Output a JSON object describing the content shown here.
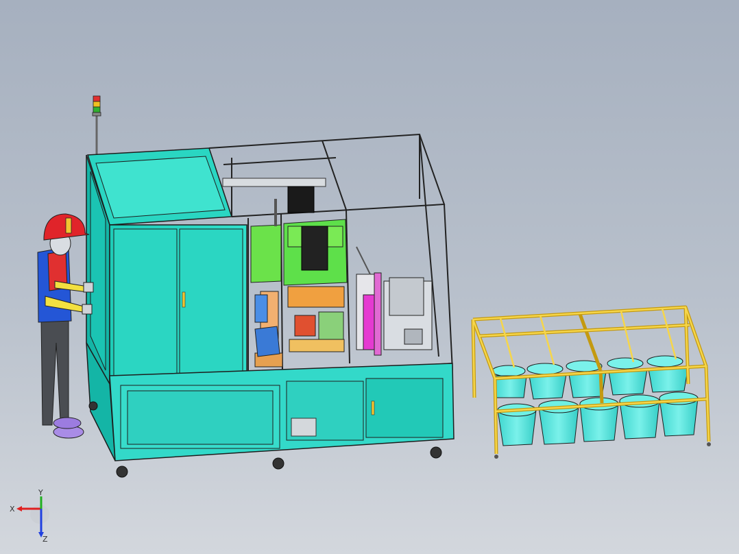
{
  "window": {
    "title": ""
  },
  "viewport": {
    "background_top": "#a6b0bf",
    "background_bottom": "#d3d7dd"
  },
  "model": {
    "frame_color": "#2b2b2b",
    "panel_color": "#22d3c0",
    "panel_light": "#6ff0e4",
    "rack_color": "#f2c531",
    "bucket_color": "#5ce8e0",
    "green_color": "#5ee04a",
    "magenta_color": "#e53ad1"
  },
  "triad": {
    "x_label": "X",
    "y_label": "Y",
    "z_label": "Z",
    "x_color": "#e02020",
    "y_color": "#20b020",
    "z_color": "#2040e0"
  }
}
